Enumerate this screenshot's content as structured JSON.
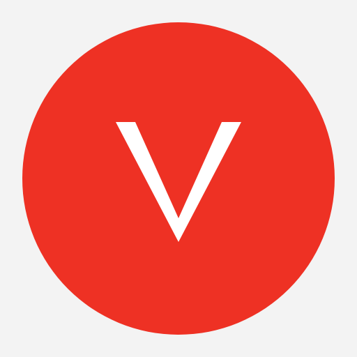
{
  "icon": {
    "name": "v-logo-icon",
    "letter": "V",
    "background_color": "#f3f3f3",
    "circle_color": "#ee3124",
    "glyph_color": "#ffffff"
  }
}
